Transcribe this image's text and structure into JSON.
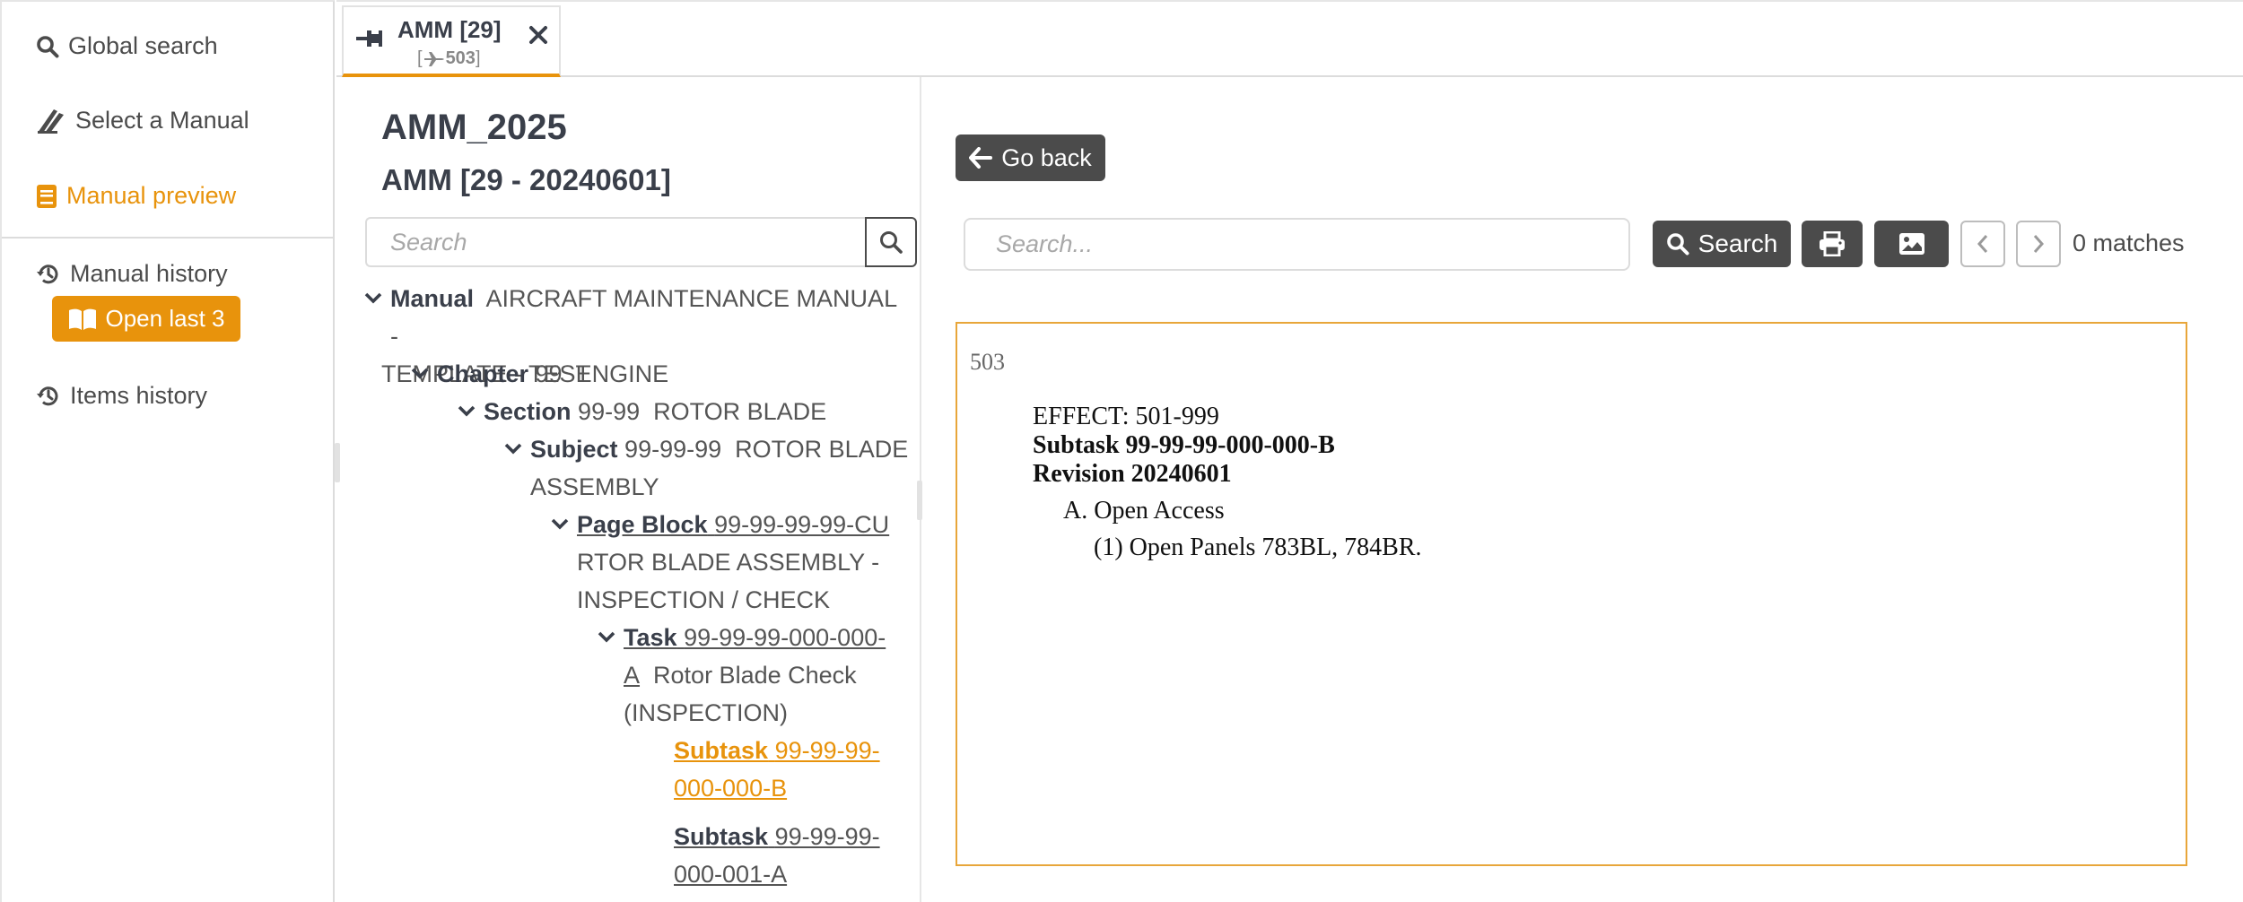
{
  "sidebar": {
    "items": [
      {
        "label": "Global search",
        "icon": "search-icon"
      },
      {
        "label": "Select a Manual",
        "icon": "manual-select-icon"
      },
      {
        "label": "Manual preview",
        "icon": "book-icon",
        "active": true
      },
      {
        "label": "Manual history",
        "icon": "history-icon"
      },
      {
        "label": "Items history",
        "icon": "history-icon"
      }
    ],
    "open_last_label": "Open last 3"
  },
  "tab": {
    "title": "AMM [29]",
    "sub_prefix": "[",
    "sub_value": "503",
    "sub_suffix": "]"
  },
  "tree": {
    "manual_title": "AMM_2025",
    "manual_subtitle": "AMM [29 - 20240601]",
    "search_placeholder": "Search",
    "nodes": [
      {
        "kw": "Manual",
        "line1": "AIRCRAFT MAINTENANCE MANUAL -",
        "line2": "TEMPLATE - TEST"
      },
      {
        "kw": "Chapter",
        "num": "99",
        "text": "ENGINE"
      },
      {
        "kw": "Section",
        "num": "99-99",
        "text": "ROTOR BLADE"
      },
      {
        "kw": "Subject",
        "num": "99-99-99",
        "text": "ROTOR BLADE",
        "line2": "ASSEMBLY"
      },
      {
        "kw": "Page Block",
        "num": "99-99-99-99-CU",
        "line2": "RTOR BLADE ASSEMBLY -",
        "line3": "INSPECTION / CHECK"
      },
      {
        "kw": "Task",
        "num": "99-99-99-000-000-",
        "num2": "A",
        "text": "Rotor Blade Check",
        "line3": "(INSPECTION)"
      },
      {
        "kw": "Subtask",
        "num": "99-99-99-",
        "num2": "000-000-B",
        "selected": true
      },
      {
        "kw": "Subtask",
        "num": "99-99-99-",
        "num2": "000-001-A"
      }
    ]
  },
  "content": {
    "go_back_label": "Go back",
    "search_placeholder": "Search...",
    "search_button_label": "Search",
    "matches_text": "0 matches",
    "document": {
      "page": "503",
      "effect": "EFFECT: 501-999",
      "subtask": "Subtask 99-99-99-000-000-B",
      "revision": "Revision 20240601",
      "step_a": "A. Open Access",
      "step_1": "(1) Open Panels 783BL, 784BR."
    }
  },
  "colors": {
    "accent": "#e8930c",
    "dark_button": "#4b4b4b",
    "text": "#4b4b4b",
    "border": "#dcdcdc"
  }
}
